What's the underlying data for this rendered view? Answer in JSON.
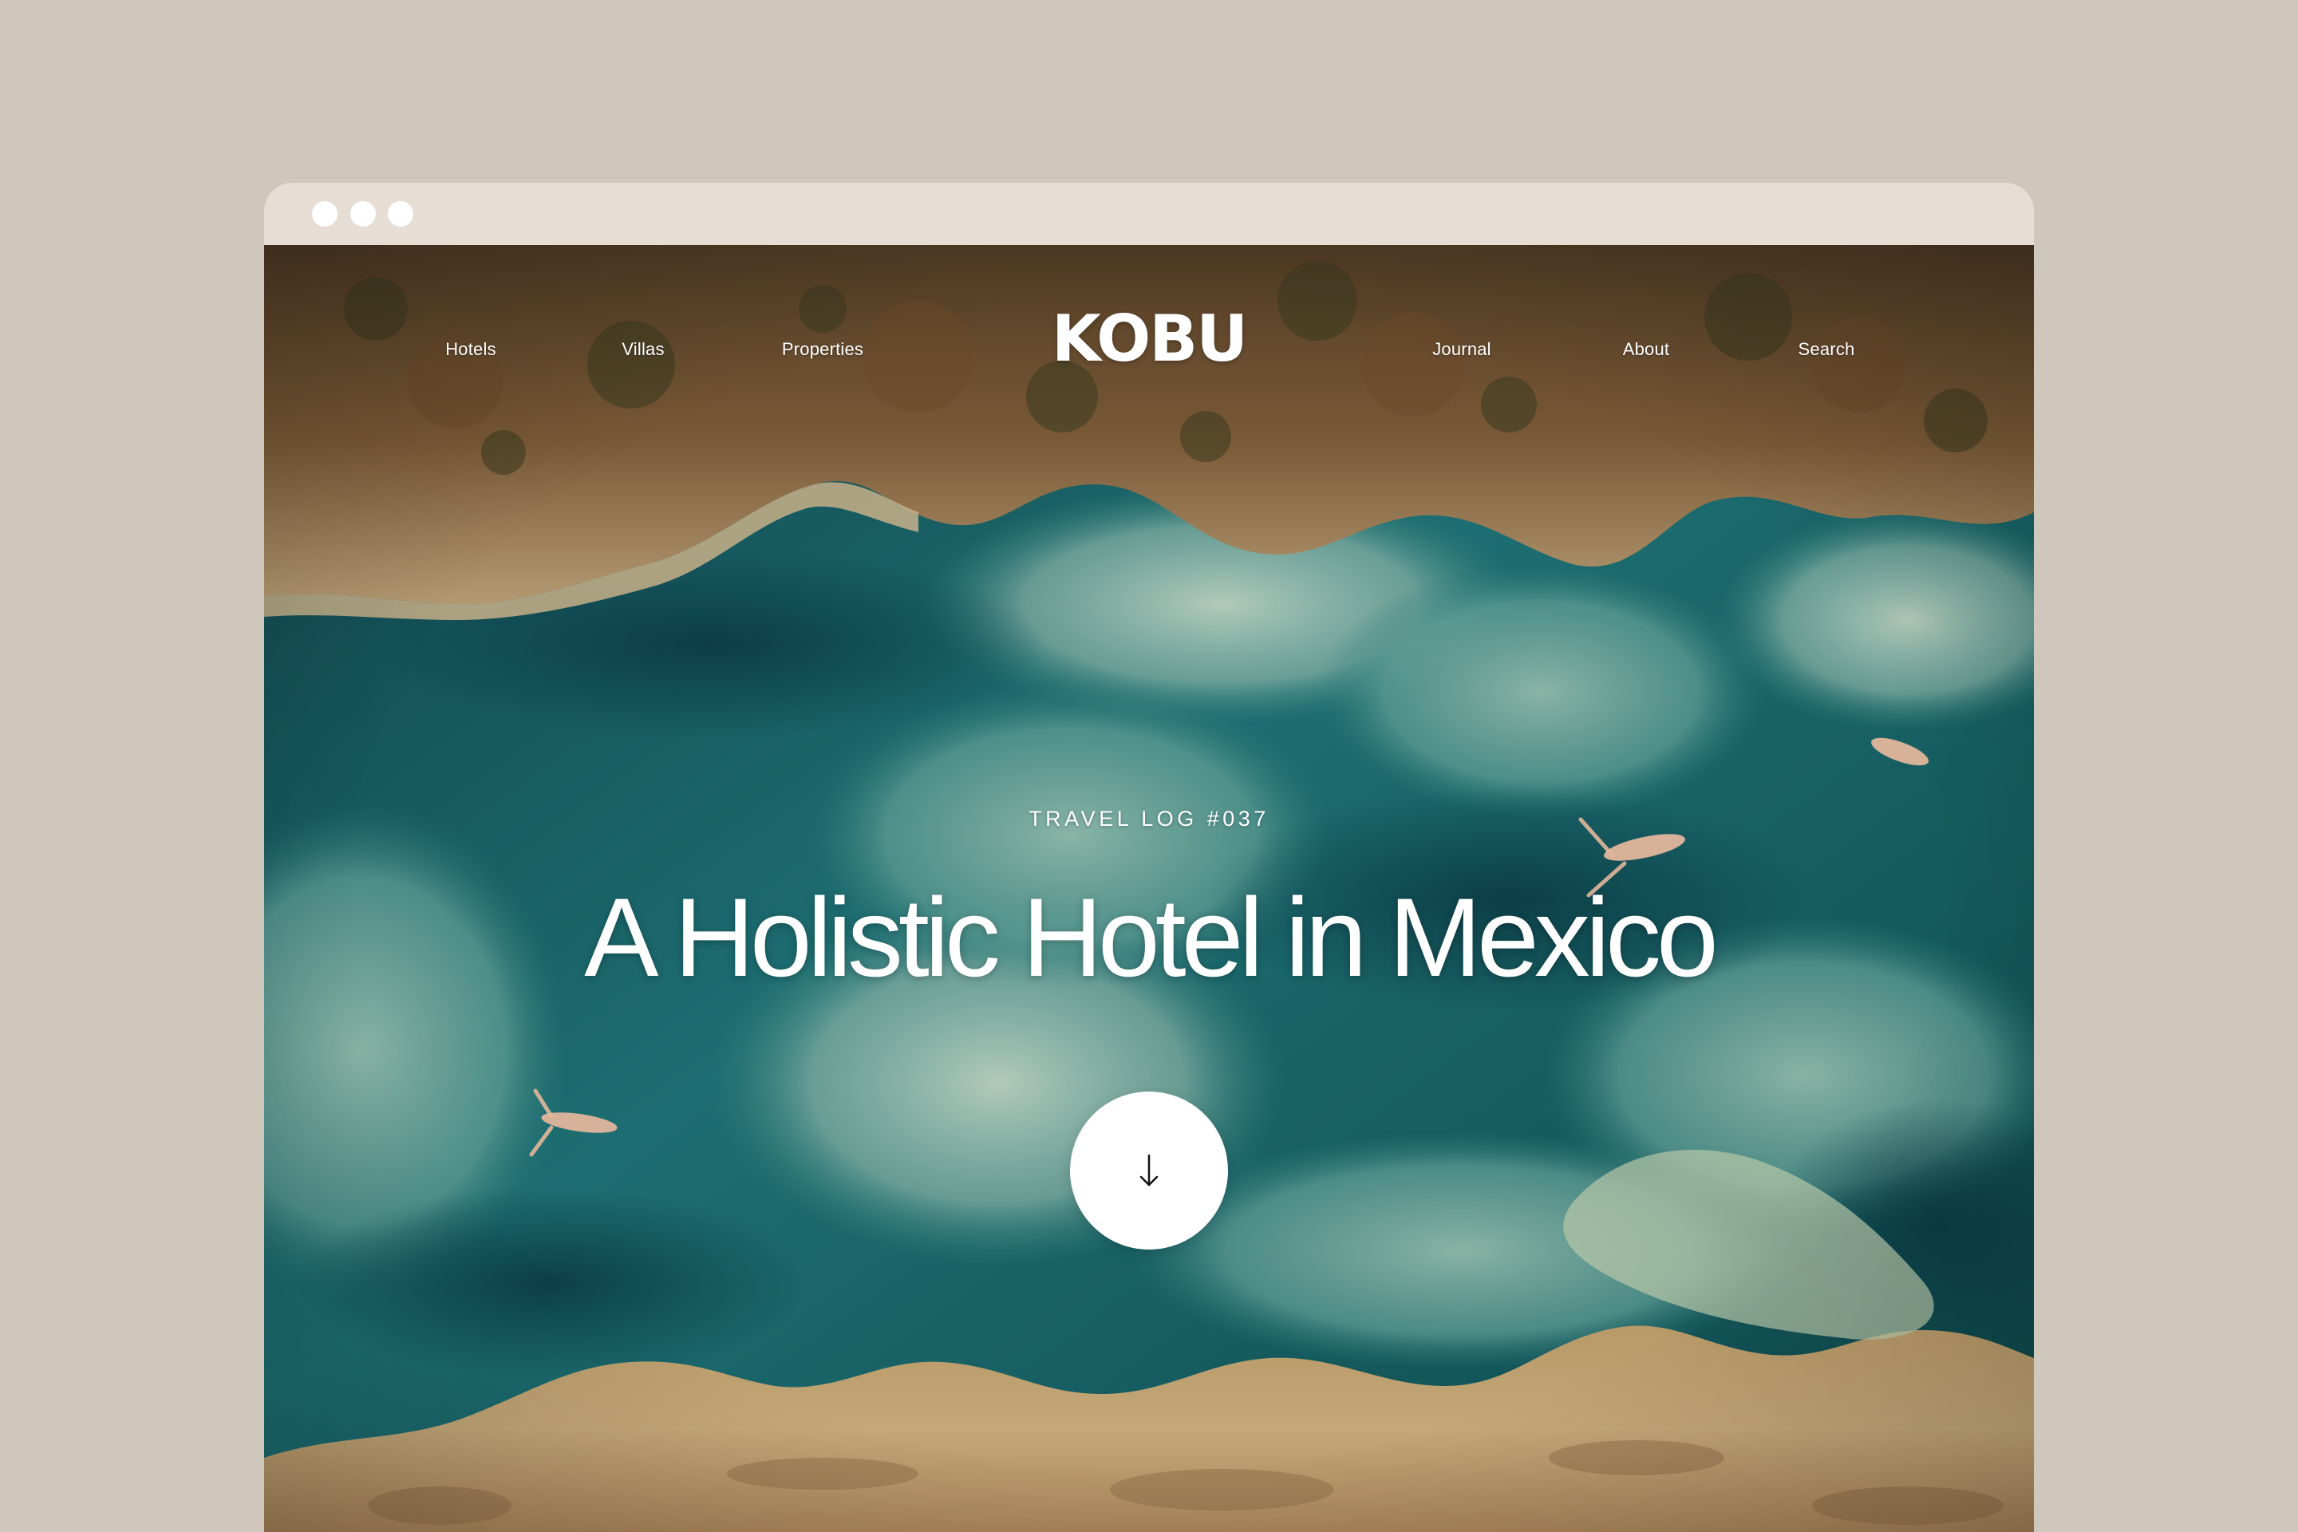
{
  "window": {
    "controls": [
      "dot",
      "dot",
      "dot"
    ]
  },
  "nav": {
    "left_items": [
      {
        "label": "Hotels"
      },
      {
        "label": "Villas"
      },
      {
        "label": "Properties"
      }
    ],
    "logo": "KOBU",
    "right_items": [
      {
        "label": "Journal"
      },
      {
        "label": "About"
      },
      {
        "label": "Search"
      }
    ]
  },
  "hero": {
    "eyebrow": "TRAVEL LOG #037",
    "title": "A Holistic Hotel in Mexico",
    "scroll_icon": "arrow-down-icon",
    "image": "aerial-photo-turquoise-river-with-swimmers"
  },
  "colors": {
    "page_background": "#cfc7bb",
    "browser_chrome": "#e6ded5",
    "window_dot": "#ffffff",
    "text": "#ffffff",
    "button": "#ffffff",
    "button_icon": "#111111"
  }
}
